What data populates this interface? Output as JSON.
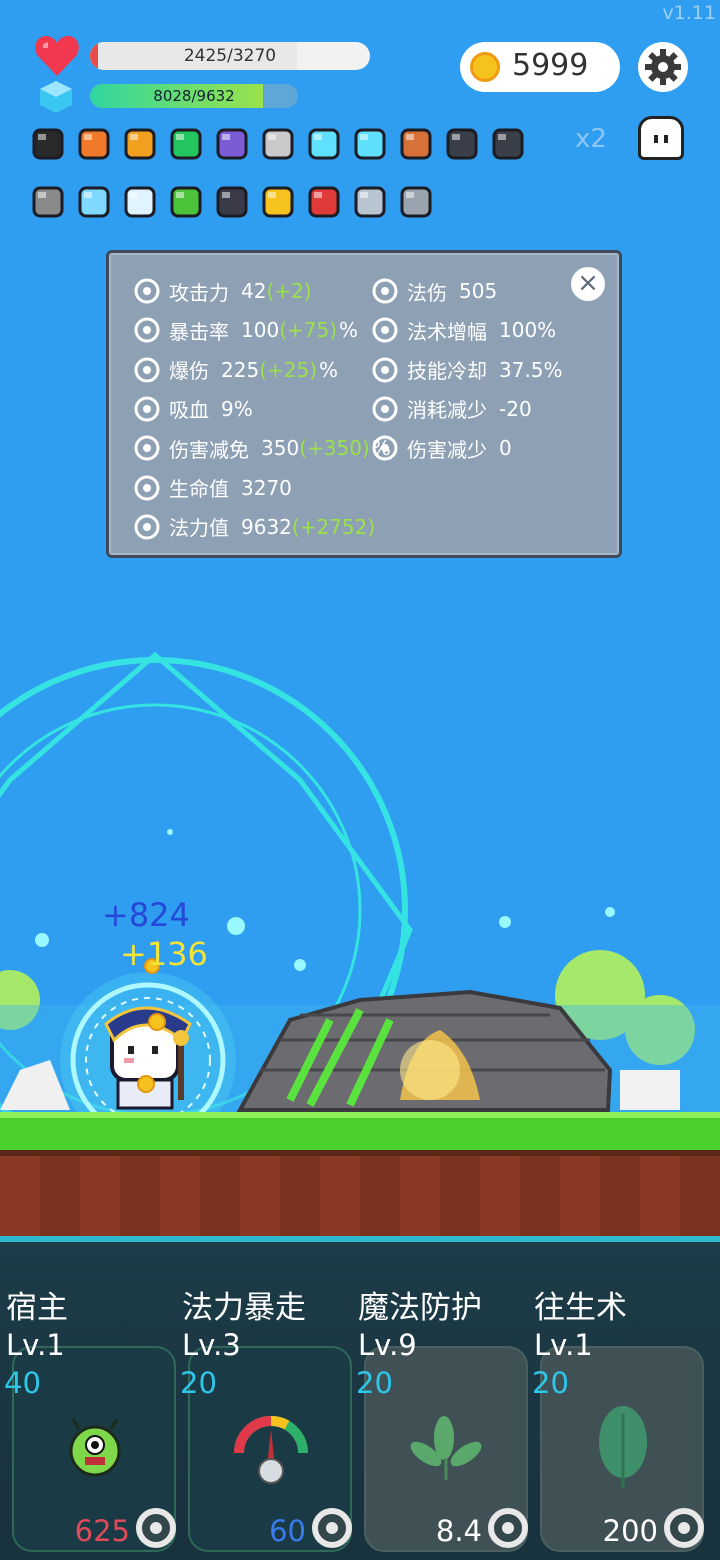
{
  "version": "v1.11",
  "hp": {
    "text": "2425/3270",
    "fraction": 0.74
  },
  "mp": {
    "text": "8028/9632",
    "fraction": 0.83
  },
  "coins": "5999",
  "multiplier": "x2",
  "items_row1": [
    "cauldron-icon",
    "torch-icon",
    "spellbook-icon",
    "emerald-icon",
    "wizard-hat-icon",
    "hook-icon",
    "diamond-icon",
    "diamond-icon",
    "shield-icon",
    "skull-tome-icon",
    "skull-tome-icon"
  ],
  "items_row2": [
    "hammer-icon",
    "ice-crystal-icon",
    "arrows-icon",
    "sprout-icon",
    "bat-icon",
    "sun-orb-icon",
    "magnet-icon",
    "sword-icon",
    "spiked-mace-icon"
  ],
  "stats_left": [
    {
      "icon": "axe-icon",
      "name": "攻击力",
      "value": "42",
      "bonus": "(+2)",
      "suffix": ""
    },
    {
      "icon": "crossed-swords-icon",
      "name": "暴击率",
      "value": "100",
      "bonus": "(+75)",
      "suffix": "%"
    },
    {
      "icon": "burst-icon",
      "name": "爆伤",
      "value": "225",
      "bonus": "(+25)",
      "suffix": "%"
    },
    {
      "icon": "skull-icon",
      "name": "吸血",
      "value": "9%",
      "bonus": "",
      "suffix": ""
    },
    {
      "icon": "shield-icon",
      "name": "伤害减免",
      "value": "350",
      "bonus": "(+350)",
      "suffix": "%"
    },
    {
      "icon": "heart-icon",
      "name": "生命值",
      "value": "3270",
      "bonus": "",
      "suffix": ""
    },
    {
      "icon": "hexagon-icon",
      "name": "法力值",
      "value": "9632",
      "bonus": "(+2752)",
      "suffix": ""
    }
  ],
  "stats_right": [
    {
      "icon": "sun-icon",
      "name": "法伤",
      "value": "505"
    },
    {
      "icon": "lightning-icon",
      "name": "法术增幅",
      "value": "100%"
    },
    {
      "icon": "hourglass-icon",
      "name": "技能冷却",
      "value": "37.5%"
    },
    {
      "icon": "wand-icon",
      "name": "消耗减少",
      "value": "-20"
    },
    {
      "icon": "shield-heart-icon",
      "name": "伤害减少",
      "value": "0"
    }
  ],
  "float_numbers": [
    "+824",
    "+136"
  ],
  "skills": [
    {
      "name": "宿主",
      "level": "Lv.1",
      "cost": "40",
      "value": "625",
      "value_color": "#e04a5a",
      "icon": "monster-icon",
      "owned": false
    },
    {
      "name": "法力暴走",
      "level": "Lv.3",
      "cost": "20",
      "value": "60",
      "value_color": "#3a7af0",
      "icon": "gauge-icon",
      "owned": false
    },
    {
      "name": "魔法防护",
      "level": "Lv.9",
      "cost": "20",
      "value": "8.4",
      "value_color": "#ffffff",
      "icon": "leaves-icon",
      "owned": true
    },
    {
      "name": "往生术",
      "level": "Lv.1",
      "cost": "20",
      "value": "200",
      "value_color": "#ffffff",
      "icon": "leaf-icon",
      "owned": true
    }
  ]
}
